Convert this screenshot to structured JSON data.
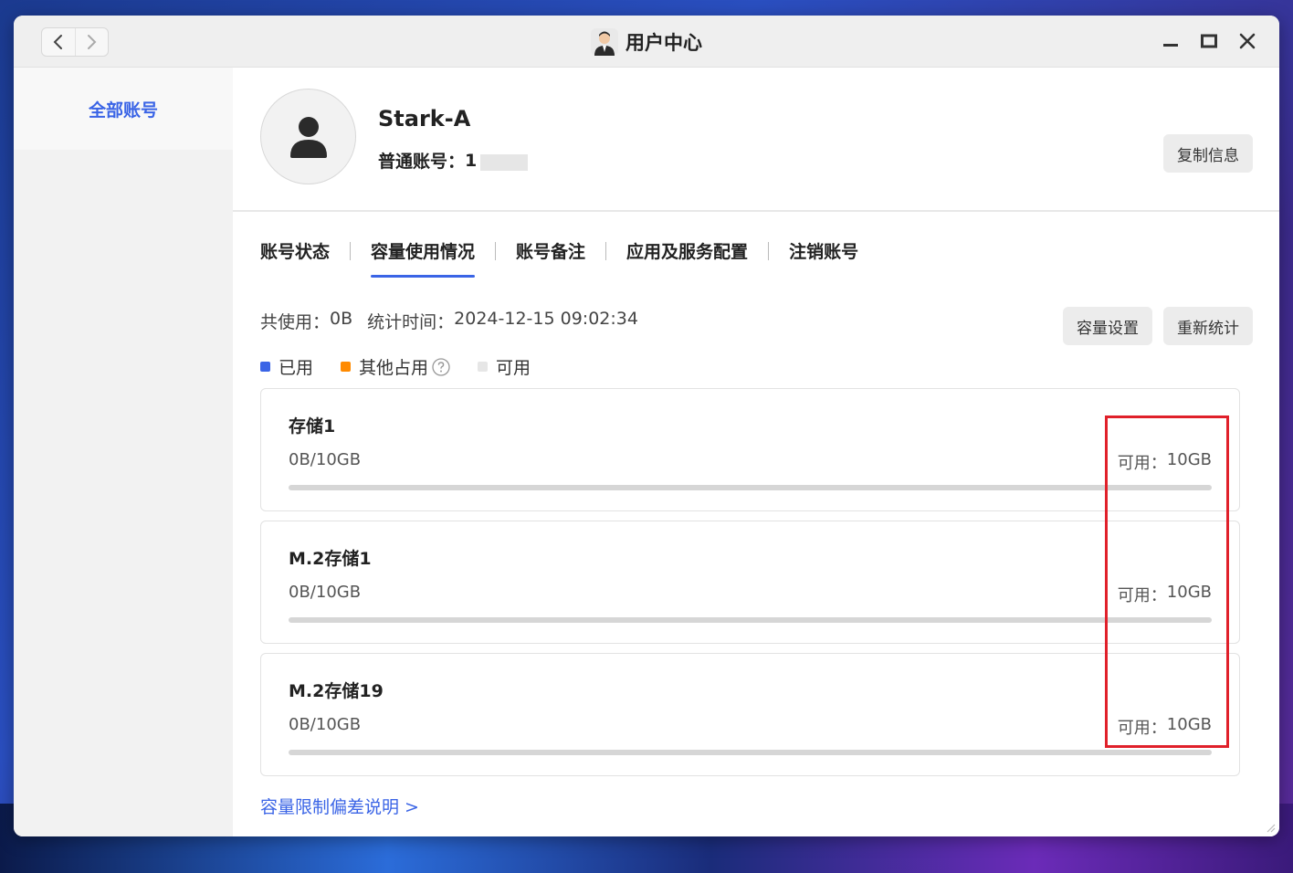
{
  "window": {
    "title": "用户中心",
    "nav_back_icon": "chevron-left-icon",
    "nav_forward_icon": "chevron-right-icon"
  },
  "sidebar": {
    "items": [
      {
        "label": "全部账号",
        "active": true
      }
    ]
  },
  "profile": {
    "name": "Stark-A",
    "account_label": "普通账号：",
    "account_value": "1",
    "copy_button": "复制信息"
  },
  "tabs": [
    {
      "label": "账号状态",
      "active": false
    },
    {
      "label": "容量使用情况",
      "active": true
    },
    {
      "label": "账号备注",
      "active": false
    },
    {
      "label": "应用及服务配置",
      "active": false
    },
    {
      "label": "注销账号",
      "active": false
    }
  ],
  "summary": {
    "total_label": "共使用：",
    "total_value": "0B",
    "time_label": "统计时间：",
    "time_value": "2024-12-15 09:02:34"
  },
  "buttons": {
    "capacity_settings": "容量设置",
    "recount": "重新统计"
  },
  "legend": [
    {
      "label": "已用",
      "color": "#3a64e6"
    },
    {
      "label": "其他占用",
      "color": "#ff8a00"
    },
    {
      "label": "可用",
      "color": "#e6e6e6"
    }
  ],
  "storages": [
    {
      "name": "存储1",
      "usage": "0B/10GB",
      "available_label": "可用：",
      "available_value": "10GB",
      "used_fraction": 0
    },
    {
      "name": "M.2存储1",
      "usage": "0B/10GB",
      "available_label": "可用：",
      "available_value": "10GB",
      "used_fraction": 0
    },
    {
      "name": "M.2存储19",
      "usage": "0B/10GB",
      "available_label": "可用：",
      "available_value": "10GB",
      "used_fraction": 0
    }
  ],
  "footer": {
    "link": "容量限制偏差说明 >"
  },
  "colors": {
    "accent": "#3a64e6",
    "highlight": "#e0202a"
  }
}
